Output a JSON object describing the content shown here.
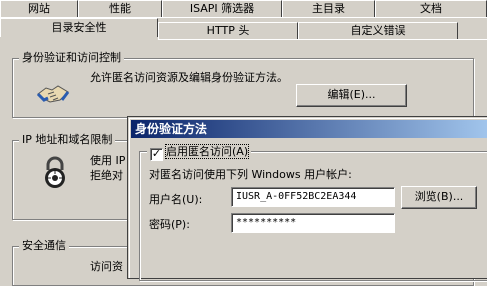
{
  "tabs_row1": [
    "网站",
    "性能",
    "ISAPI 筛选器",
    "主目录",
    "文档"
  ],
  "tabs_row2": [
    "目录安全性",
    "HTTP 头",
    "自定义错误"
  ],
  "auth_group": {
    "legend": "身份验证和访问控制",
    "description": "允许匿名访问资源及编辑身份验证方法。",
    "edit_button": "编辑(E)..."
  },
  "ip_group": {
    "legend": "IP 地址和域名限制",
    "text_line1": "使用 IP",
    "text_line2": "拒绝对"
  },
  "secure_group": {
    "legend": "安全通信",
    "text_partial": "访问资"
  },
  "dialog": {
    "title": "身份验证方法",
    "anon_checkbox_label": "启用匿名访问(A)",
    "anon_checked": true,
    "account_caption": "对匿名访问使用下列 Windows 用户帐户:",
    "username_label": "用户名(U):",
    "username_value": "IUSR_A-0FF52BC2EA344",
    "browse_button": "浏览(B)...",
    "password_label": "密码(P):",
    "password_value": "**********"
  }
}
